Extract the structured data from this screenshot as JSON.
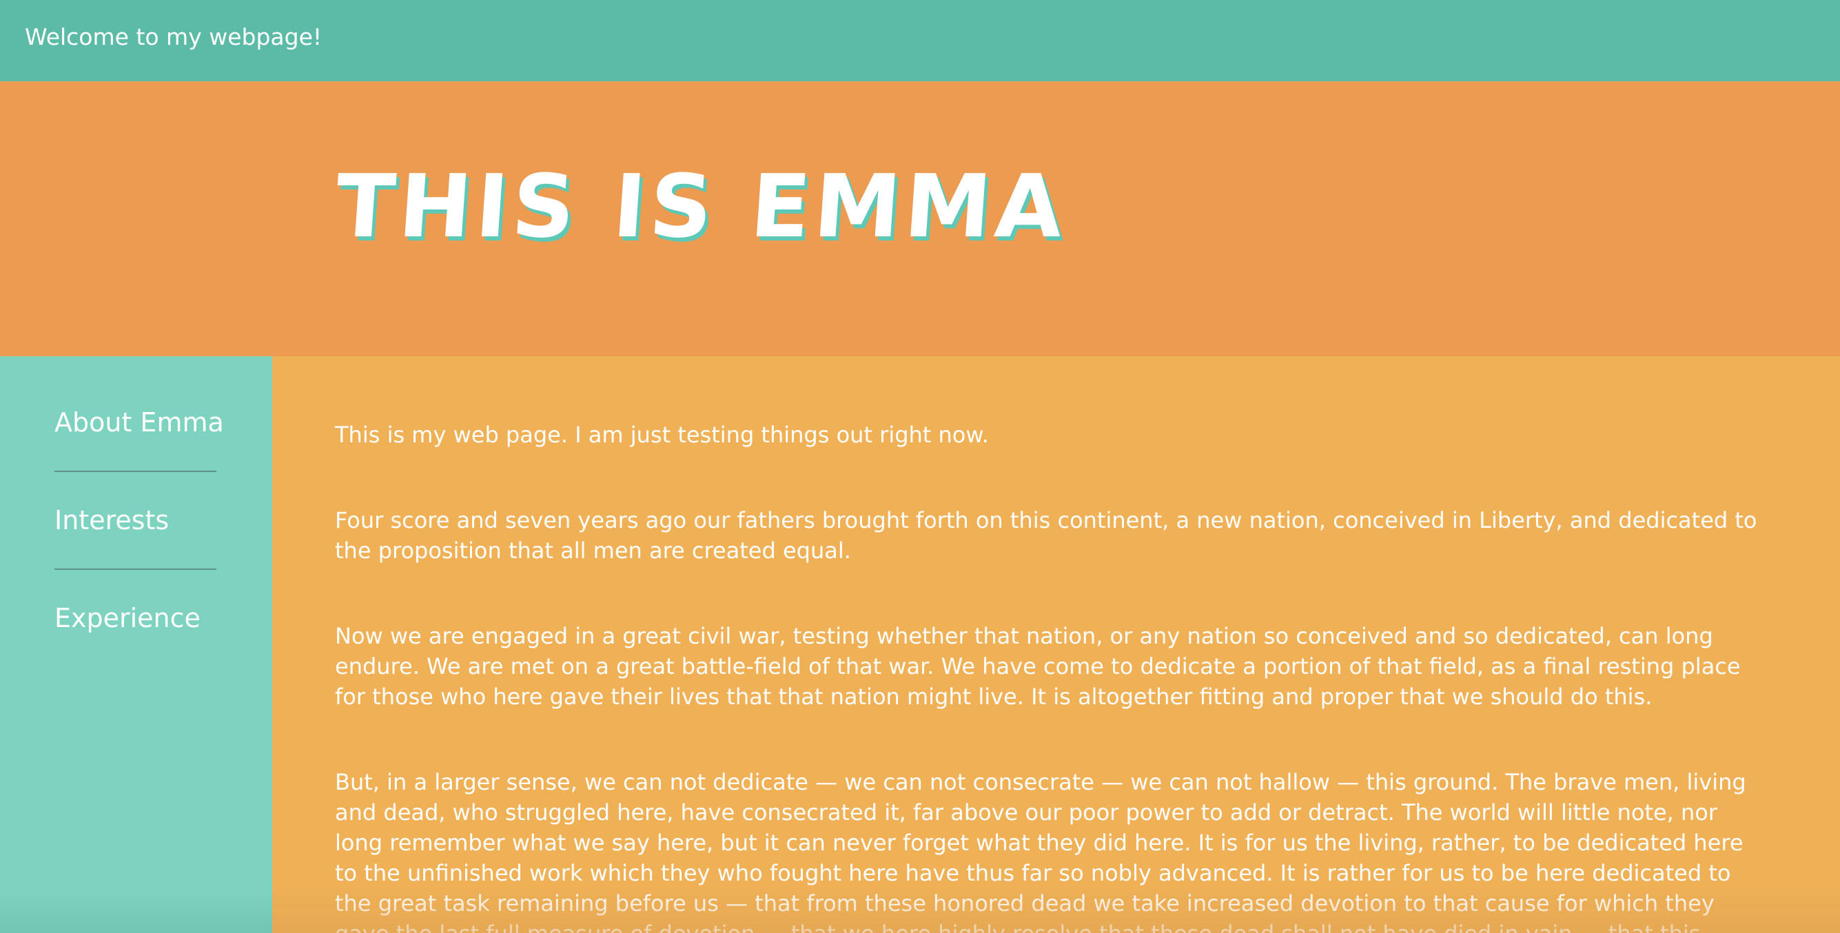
{
  "topbar": {
    "welcome_text": "Welcome to my webpage!"
  },
  "hero": {
    "title": "THIS IS EMMA"
  },
  "sidebar": {
    "items": [
      {
        "label": "About Emma"
      },
      {
        "label": "Interests"
      },
      {
        "label": "Experience"
      }
    ]
  },
  "main": {
    "paragraphs": [
      "This is my web page. I am just testing things out right now.",
      "Four score and seven years ago our fathers brought forth on this continent, a new nation, conceived in Liberty, and dedicated to the proposition that all men are created equal.",
      "Now we are engaged in a great civil war, testing whether that nation, or any nation so conceived and so dedicated, can long endure. We are met on a great battle-field of that war. We have come to dedicate a portion of that field, as a final resting place for those who here gave their lives that that nation might live. It is altogether fitting and proper that we should do this.",
      "But, in a larger sense, we can not dedicate — we can not consecrate — we can not hallow — this ground. The brave men, living and dead, who struggled here, have consecrated it, far above our poor power to add or detract. The world will little note, nor long remember what we say here, but it can never forget what they did here. It is for us the living, rather, to be dedicated here to the unfinished work which they who fought here have thus far so nobly advanced. It is rather for us to be here dedicated to the great task remaining before us — that from these honored dead we take increased devotion to that cause for which they gave the last full measure of devotion — that we here highly resolve that these dead shall not have died in vain — that this nation, under God, shall have a new birth of freedom — and that"
    ]
  },
  "colors": {
    "topbar": "#5bbba7",
    "hero": "#ee9b52",
    "sidebar": "#7dd3bf",
    "content": "#efb056",
    "title_shadow": "#5dc8b6",
    "text": "#ffffff"
  }
}
